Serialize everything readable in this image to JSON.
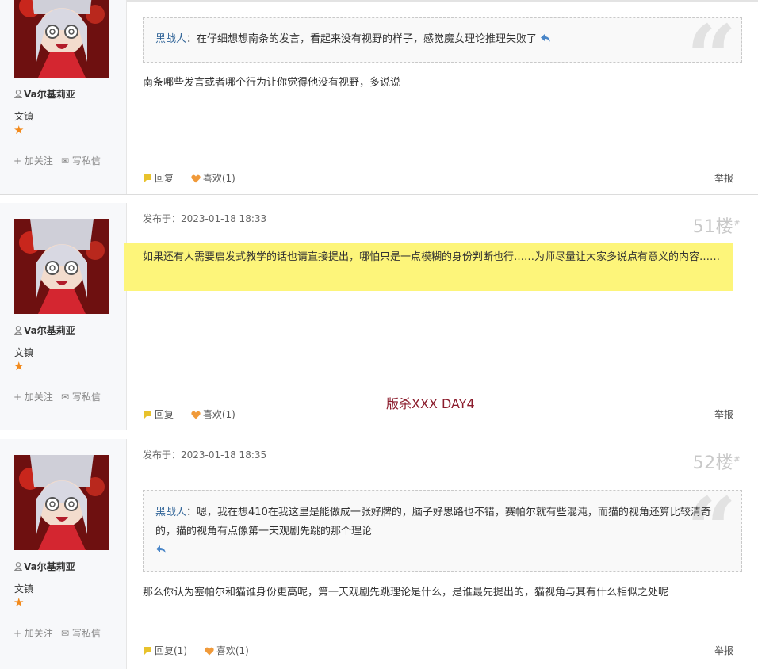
{
  "posts": [
    {
      "user": {
        "name": "Va尔基莉亚",
        "rank": "文镇",
        "follow": "加关注",
        "pm": "写私信"
      },
      "quote": {
        "author": "黑战人",
        "separator": "：",
        "text": "在仔细想想南条的发言，看起来没有视野的样子，感觉魔女理论推理失败了"
      },
      "body": "南条哪些发言或者哪个行为让你觉得他没有视野，多说说",
      "actions": {
        "reply": "回复",
        "like": "喜欢(1)",
        "report": "举报"
      }
    },
    {
      "user": {
        "name": "Va尔基莉亚",
        "rank": "文镇",
        "follow": "加关注",
        "pm": "写私信"
      },
      "meta": "发布于：2023-01-18 18:33",
      "floor": "51楼",
      "floor_mark": "#",
      "body": "如果还有人需要启发式教学的话也请直接提出，哪怕只是一点模糊的身份判断也行……为师尽量让大家多说点有意义的内容……",
      "actions": {
        "reply": "回复",
        "like": "喜欢(1)",
        "report": "举报"
      }
    },
    {
      "user": {
        "name": "Va尔基莉亚",
        "rank": "文镇",
        "follow": "加关注",
        "pm": "写私信"
      },
      "meta": "发布于：2023-01-18 18:35",
      "floor": "52楼",
      "floor_mark": "#",
      "quote": {
        "author": "黑战人",
        "separator": "：",
        "text": "嗯，我在想410在我这里是能做成一张好牌的，脑子好思路也不错，赛帕尔就有些混沌，而猫的视角还算比较清奇的，猫的视角有点像第一天观剧先跳的那个理论"
      },
      "body": "那么你认为塞帕尔和猫谁身份更高呢，第一天观剧先跳理论是什么，是谁最先提出的，猫视角与其有什么相似之处呢",
      "actions": {
        "reply": "回复(1)",
        "like": "喜欢(1)",
        "report": "举报"
      }
    }
  ],
  "overlay_text": "版杀XXX DAY4",
  "colors": {
    "link_blue": "#336699",
    "star": "#f28a1c",
    "highlight": "#fdf57a",
    "overlay": "#8b1c2c"
  }
}
